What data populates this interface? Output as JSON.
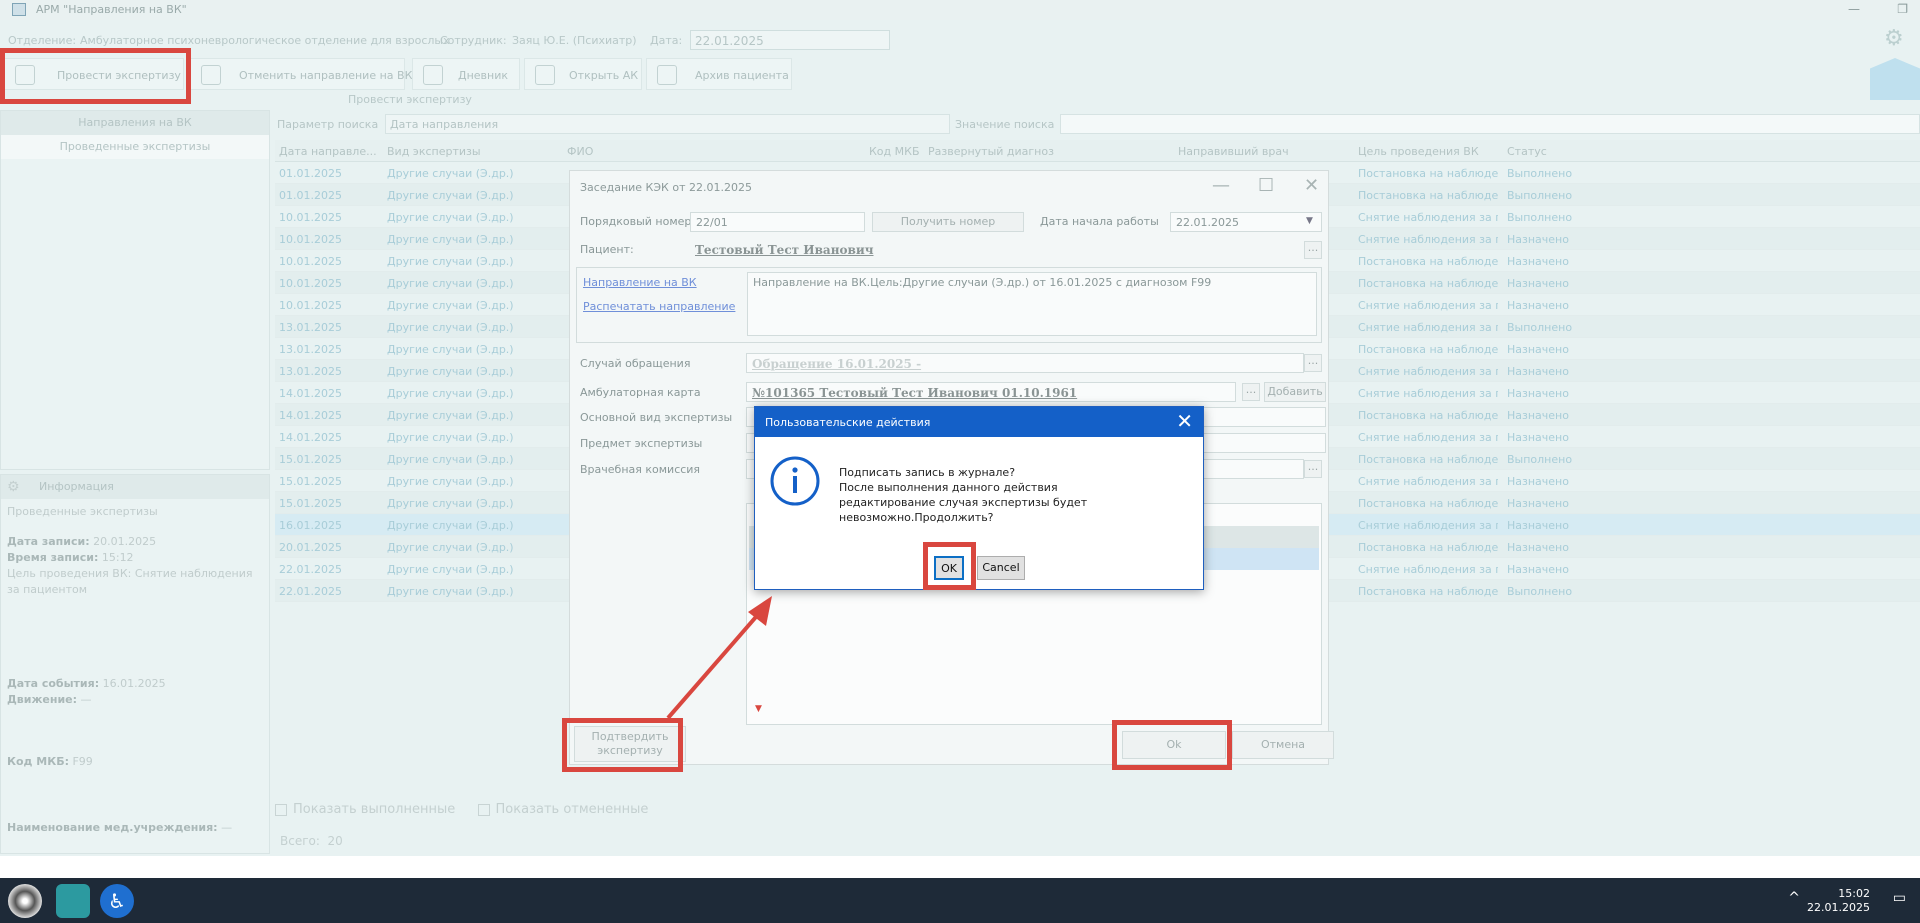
{
  "window": {
    "title": "АРМ \"Направления на ВК\"",
    "minimize": "—",
    "restore": "❐"
  },
  "info_row": {
    "dept_label": "Отделение:",
    "dept_value": "Амбулаторное психоневрологическое отделение для взрослых",
    "employee_label": "Сотрудник:",
    "employee_value": "Заяц Ю.Е. (Психиатр)",
    "date_label": "Дата:",
    "date_value": "22.01.2025"
  },
  "toolbar": {
    "btn1": "Провести экспертизу",
    "btn2": "Отменить направление на ВК",
    "btn3": "Дневник",
    "btn4": "Открыть АК",
    "btn5": "Архив пациента",
    "sublabel": "Провести экспертизу"
  },
  "leftnav": {
    "item1": "Направления на ВК",
    "item2": "Проведенные экспертизы"
  },
  "infopanel": {
    "header": "Информация",
    "l1": "Проведенные экспертизы",
    "l2_label": "Дата записи:",
    "l2_value": "20.01.2025",
    "l3_label": "Время записи:",
    "l3_value": "15:12",
    "l4": "Цель проведения ВК: Снятие наблюдения",
    "l5": "за пациентом",
    "l6_label": "Дата события:",
    "l6_value": "16.01.2025",
    "l7_label": "Движение:",
    "l7_value": "—",
    "l8_label": "Код МКБ:",
    "l8_value": "F99",
    "l9_label": "Наименование мед.учреждения:",
    "l9_value": "—"
  },
  "search": {
    "param_label": "Параметр поиска",
    "param_value": "Дата направления",
    "value_label": "Значение поиска"
  },
  "grid": {
    "headers": [
      "Дата направле...",
      "Вид экспертизы",
      "ФИО",
      "Код МКБ",
      "Развернутый диагноз",
      "Направивший врач",
      "Цель проведения ВК",
      "Статус"
    ],
    "rows": [
      [
        "01.01.2025",
        "Другие случаи (Э.др.)",
        "Постановка на наблюдени...",
        "Выполнено"
      ],
      [
        "01.01.2025",
        "Другие случаи (Э.др.)",
        "Постановка на наблюдени...",
        "Выполнено"
      ],
      [
        "10.01.2025",
        "Другие случаи (Э.др.)",
        "Снятие наблюдения за пац...",
        "Выполнено"
      ],
      [
        "10.01.2025",
        "Другие случаи (Э.др.)",
        "Снятие наблюдения за пац...",
        "Назначено"
      ],
      [
        "10.01.2025",
        "Другие случаи (Э.др.)",
        "Постановка на наблюдени...",
        "Назначено"
      ],
      [
        "10.01.2025",
        "Другие случаи (Э.др.)",
        "Постановка на наблюдени...",
        "Назначено"
      ],
      [
        "10.01.2025",
        "Другие случаи (Э.др.)",
        "Снятие наблюдения за пац...",
        "Назначено"
      ],
      [
        "13.01.2025",
        "Другие случаи (Э.др.)",
        "Снятие наблюдения за пац...",
        "Выполнено"
      ],
      [
        "13.01.2025",
        "Другие случаи (Э.др.)",
        "Постановка на наблюдени...",
        "Назначено"
      ],
      [
        "13.01.2025",
        "Другие случаи (Э.др.)",
        "Снятие наблюдения за пац...",
        "Назначено"
      ],
      [
        "14.01.2025",
        "Другие случаи (Э.др.)",
        "Снятие наблюдения за пац...",
        "Назначено"
      ],
      [
        "14.01.2025",
        "Другие случаи (Э.др.)",
        "Постановка на наблюдени...",
        "Назначено"
      ],
      [
        "14.01.2025",
        "Другие случаи (Э.др.)",
        "Снятие наблюдения за пац...",
        "Назначено"
      ],
      [
        "15.01.2025",
        "Другие случаи (Э.др.)",
        "Постановка на наблюдени...",
        "Выполнено"
      ],
      [
        "15.01.2025",
        "Другие случаи (Э.др.)",
        "Снятие наблюдения за пац...",
        "Назначено"
      ],
      [
        "15.01.2025",
        "Другие случаи (Э.др.)",
        "Постановка на наблюдени...",
        "Назначено"
      ],
      [
        "16.01.2025",
        "Другие случаи (Э.др.)",
        "Снятие наблюдения за пац...",
        "Назначено"
      ],
      [
        "20.01.2025",
        "Другие случаи (Э.др.)",
        "Постановка на наблюдени...",
        "Назначено"
      ],
      [
        "22.01.2025",
        "Другие случаи (Э.др.)",
        "Снятие наблюдения за пац...",
        "Назначено"
      ],
      [
        "22.01.2025",
        "Другие случаи (Э.др.)",
        "Постановка на наблюдени...",
        "Выполнено"
      ]
    ]
  },
  "footer": {
    "show_done": "Показать выполненные",
    "show_canceled": "Показать отмененные",
    "total_label": "Всего:",
    "total_value": "20"
  },
  "commission": {
    "title": "Заседание КЭК от 22.01.2025",
    "order_label": "Порядковый номер",
    "order_value": "22/01",
    "get_number": "Получить номер",
    "start_label": "Дата начала работы",
    "start_value": "22.01.2025",
    "patient_label": "Пациент:",
    "patient_value": "Тестовый Тест Иванович",
    "link_referral": "Направление на ВК",
    "link_print": "Распечатать направление",
    "referral_text": "Направление на ВК.Цель:Другие случаи (Э.др.) от 16.01.2025 с диагнозом F99",
    "case_label": "Случай обращения",
    "case_value": "Обращение 16.01.2025 -",
    "card_label": "Амбулаторная карта",
    "card_value": "№101365 Тестовый Тест Иванович 01.10.1961",
    "add_btn": "Добавить",
    "kind_label": "Основной вид экспертизы",
    "subject_label": "Предмет экспертизы",
    "commission_label": "Врачебная комиссия",
    "confirm_btn": "Подтвердить экспертизу",
    "ok_btn": "Ok",
    "cancel_btn": "Отмена"
  },
  "dialog": {
    "title": "Пользовательские действия",
    "line1": "Подписать запись в журнале?",
    "line2": "После выполнения данного действия",
    "line3": "редактирование случая экспертизы будет",
    "line4": "невозможно.Продолжить?",
    "ok": "OK",
    "cancel": "Cancel"
  },
  "taskbar": {
    "time": "15:02",
    "date": "22.01.2025"
  },
  "colors": {
    "annotation": "#d9473f",
    "dialog_header": "#1460c8",
    "taskbar": "#1e2a38"
  }
}
